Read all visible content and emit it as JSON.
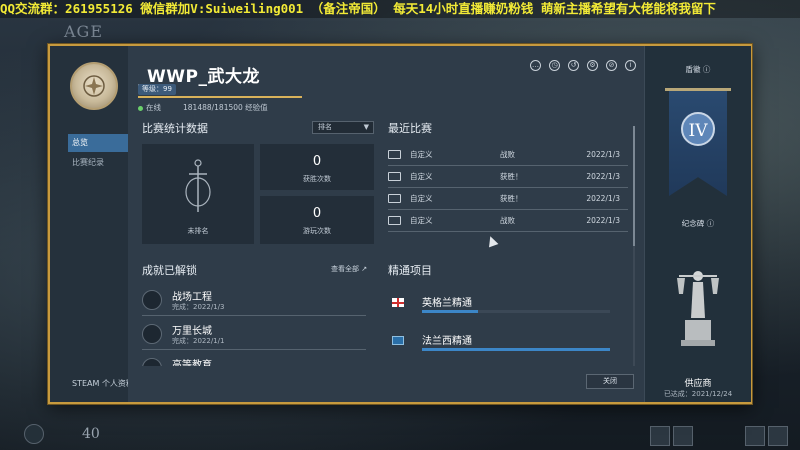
{
  "banner": {
    "text": "QQ交流群：261955126 微信群加V:Suiweiling001 （备注帝国） 每天14小时直播赚奶粉钱  萌新主播希望有大佬能将我留下"
  },
  "background": {
    "logo_text": "AGE",
    "level_text": "40"
  },
  "nav": {
    "items": [
      {
        "label": "总览",
        "active": true
      },
      {
        "label": "比赛纪录",
        "active": false
      }
    ],
    "steam_link": "STEAM 个人资料 ↗"
  },
  "player": {
    "name": "_WWP_武大龙",
    "level_label": "等级：99",
    "status": "在线",
    "xp_text": "181488/181500 经验值",
    "xp_progress": 0.9999
  },
  "stats": {
    "title": "比赛统计数据",
    "sort_label": "排名",
    "rank_label": "未排名",
    "wins_value": "0",
    "wins_label": "获胜次数",
    "played_value": "0",
    "played_label": "游玩次数"
  },
  "recent": {
    "title": "最近比赛",
    "rows": [
      {
        "mode": "自定义",
        "result": "战败",
        "date": "2022/1/3"
      },
      {
        "mode": "自定义",
        "result": "获胜！",
        "date": "2022/1/3"
      },
      {
        "mode": "自定义",
        "result": "获胜！",
        "date": "2022/1/3"
      },
      {
        "mode": "自定义",
        "result": "战败",
        "date": "2022/1/3"
      }
    ]
  },
  "achievements": {
    "title": "成就已解锁",
    "view_all": "查看全部 ↗",
    "items": [
      {
        "name": "战场工程",
        "date": "完成：2022/1/3"
      },
      {
        "name": "万里长城",
        "date": "完成：2022/1/1"
      },
      {
        "name": "高等教育",
        "date": ""
      }
    ]
  },
  "mastery": {
    "title": "精通项目",
    "items": [
      {
        "name": "英格兰精通",
        "progress": 0.3
      },
      {
        "name": "法兰西精通",
        "progress": 1.0
      }
    ]
  },
  "sidebar_right": {
    "banner_title": "盾徽 ⓘ",
    "tier": "IV",
    "monument_title": "纪念碑 ⓘ",
    "monument_name": "供应商",
    "monument_date": "已达成：2021/12/24"
  },
  "close_label": "关闭",
  "header_icons": [
    "message-icon",
    "clock-icon",
    "history-icon",
    "settings-icon",
    "block-icon",
    "info-icon"
  ]
}
